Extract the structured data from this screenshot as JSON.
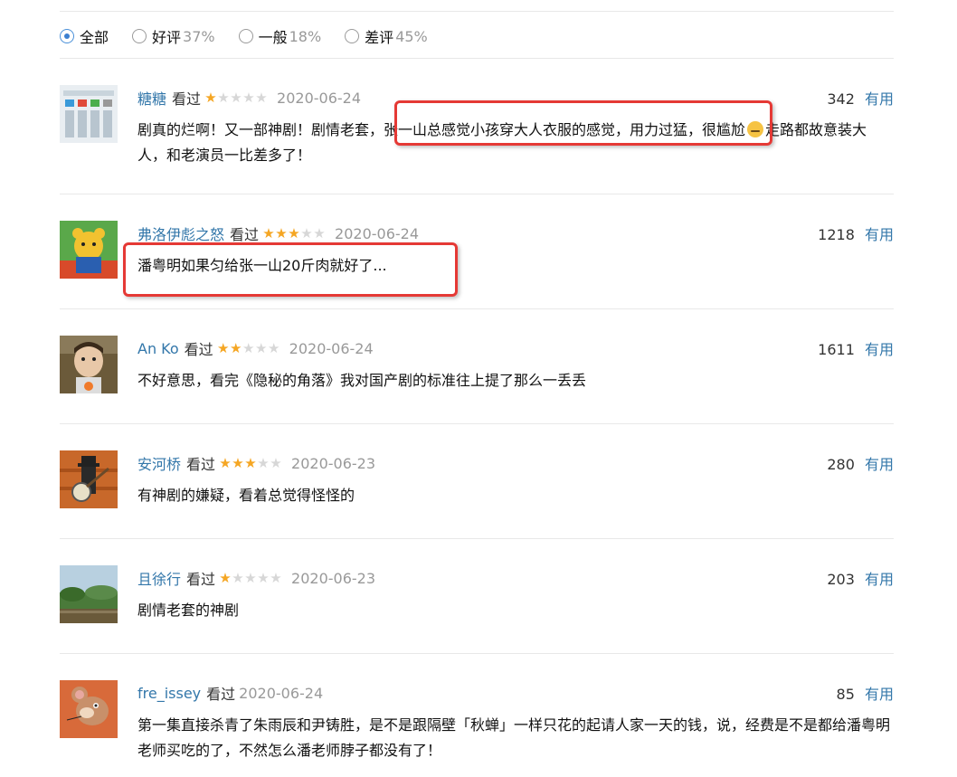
{
  "filters": [
    {
      "label": "全部",
      "pct": "",
      "checked": true
    },
    {
      "label": "好评",
      "pct": "37%",
      "checked": false
    },
    {
      "label": "一般",
      "pct": "18%",
      "checked": false
    },
    {
      "label": "差评",
      "pct": "45%",
      "checked": false
    }
  ],
  "reviews": [
    {
      "username": "糖糖",
      "watched": "看过",
      "rating": 1,
      "date": "2020-06-24",
      "votes": "342",
      "vote_label": "有用",
      "content_a": "剧真的烂啊！又一部神剧！剧情老套，张一山总感觉小孩穿大人衣服的感觉，用力过猛，很尴尬",
      "content_b": "走路都故意装大人，和老演员一比差多了！",
      "avatar_icon": "photo-thumbnail-icon"
    },
    {
      "username": "弗洛伊彪之怒",
      "watched": "看过",
      "rating": 3,
      "date": "2020-06-24",
      "votes": "1218",
      "vote_label": "有用",
      "content_a": "潘粤明如果匀给张一山20斤肉就好了...",
      "avatar_icon": "cartoon-bear-icon"
    },
    {
      "username": "An Ko",
      "watched": "看过",
      "rating": 2,
      "date": "2020-06-24",
      "votes": "1611",
      "vote_label": "有用",
      "content_a": "不好意思，看完《隐秘的角落》我对国产剧的标准往上提了那么一丢丢",
      "avatar_icon": "child-photo-icon"
    },
    {
      "username": "安河桥",
      "watched": "看过",
      "rating": 3,
      "date": "2020-06-23",
      "votes": "280",
      "vote_label": "有用",
      "content_a": "有神剧的嫌疑，看着总觉得怪怪的",
      "avatar_icon": "banjo-player-icon"
    },
    {
      "username": "且徐行",
      "watched": "看过",
      "rating": 1,
      "date": "2020-06-23",
      "votes": "203",
      "vote_label": "有用",
      "content_a": "剧情老套的神剧",
      "avatar_icon": "landscape-photo-icon"
    },
    {
      "username": "fre_issey",
      "watched": "看过",
      "rating": 0,
      "date": "2020-06-24",
      "votes": "85",
      "vote_label": "有用",
      "content_a": "第一集直接杀青了朱雨辰和尹铸胜，是不是跟隔壁「秋蝉」一样只花的起请人家一天的钱，说，经费是不是都给潘粤明老师买吃的了，不然怎么潘老师脖子都没有了！",
      "avatar_icon": "cartoon-mouse-icon"
    }
  ]
}
